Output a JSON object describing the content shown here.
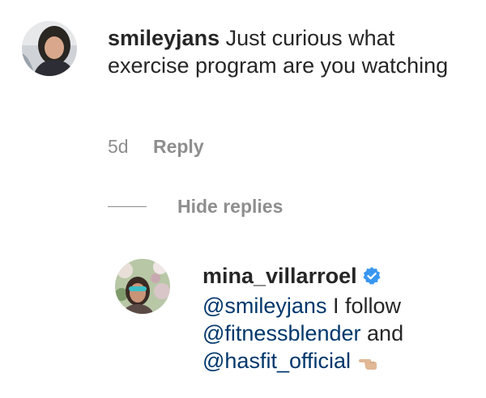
{
  "comment": {
    "username": "smileyjans",
    "text": "Just curious what exercise program are you watching",
    "time": "5d",
    "reply_label": "Reply",
    "avatar_icon": "user-avatar-photo"
  },
  "replies_toggle": {
    "label": "Hide replies"
  },
  "reply": {
    "username": "mina_villarroel",
    "verified": true,
    "verified_icon": "verified-badge-icon",
    "mention_1": "@smileyjans",
    "text_1": "I follow",
    "mention_2": "@fitnessblender",
    "text_2": "and",
    "mention_3": "@hasfit_official",
    "emoji_icon": "pointing-left-hand-icon",
    "avatar_icon": "user-avatar-photo"
  },
  "colors": {
    "text": "#262626",
    "secondary": "#8e8e8e",
    "link": "#00376b",
    "verified": "#3897f0"
  }
}
